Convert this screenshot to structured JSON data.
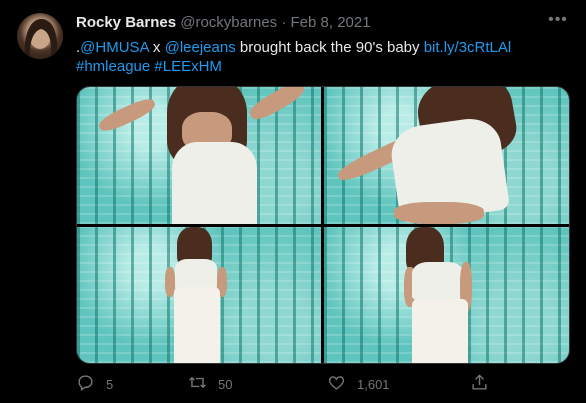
{
  "tweet": {
    "author_name": "Rocky Barnes",
    "author_handle": "@rockybarnes",
    "separator": "·",
    "date": "Feb 8, 2021",
    "more_glyph": "•••",
    "text_prefix": ".",
    "mention_hm": "@HMUSA",
    "text_x": " x ",
    "mention_lee": "@leejeans",
    "text_body": " brought back the 90's baby ",
    "link": "bit.ly/3cRtLAl",
    "hashtag_1": "#hmleague",
    "hashtag_2": "#LEExHM"
  },
  "actions": {
    "reply_count": "5",
    "retweet_count": "50",
    "like_count": "1,601"
  },
  "icons": [
    "reply-icon",
    "retweet-icon",
    "like-icon",
    "share-icon",
    "more-icon"
  ],
  "colors": {
    "background": "#000000",
    "link": "#1d9bf0",
    "muted": "#71767b",
    "photo_teal": "#5fc4bd"
  }
}
